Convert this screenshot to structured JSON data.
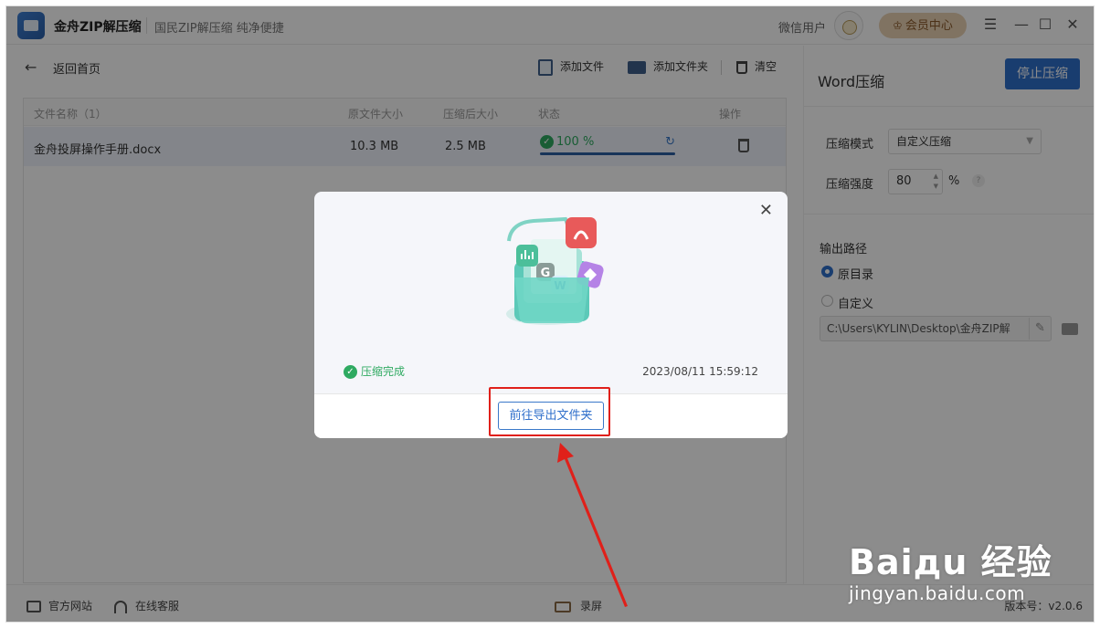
{
  "titlebar": {
    "app_name": "金舟ZIP解压缩",
    "slogan": "国民ZIP解压缩  纯净便捷",
    "user_name": "微信用户",
    "vip_label": "会员中心",
    "menu_icon": "☰",
    "min_icon": "—",
    "max_icon": "☐",
    "close_icon": "✕"
  },
  "toolbar": {
    "back_label": "返回首页",
    "add_file": "添加文件",
    "add_folder": "添加文件夹",
    "clear": "清空"
  },
  "table": {
    "headers": [
      "文件名称（1）",
      "原文件大小",
      "压缩后大小",
      "状态",
      "操作"
    ],
    "rows": [
      {
        "name": "金舟投屏操作手册.docx",
        "original_size": "10.3 MB",
        "compressed_size": "2.5 MB",
        "progress_text": "100 %",
        "progress": 1.0
      }
    ]
  },
  "side": {
    "title": "Word压缩",
    "stop_label": "停止压缩",
    "mode_label": "压缩模式",
    "mode_value": "自定义压缩",
    "strength_label": "压缩强度",
    "strength_value": "80",
    "percent": "%",
    "help": "?",
    "output_label": "输出路径",
    "option_original": "原目录",
    "option_custom": "自定义",
    "path_value": "C:\\Users\\KYLIN\\Desktop\\金舟ZIP解"
  },
  "statusbar": {
    "website": "官方网站",
    "support": "在线客服",
    "record": "录屏",
    "version": "版本号：v2.0.6"
  },
  "dialog": {
    "status": "压缩完成",
    "time": "2023/08/11 15:59:12",
    "export_label": "前往导出文件夹",
    "close": "✕"
  },
  "watermark": {
    "brand": "Baiдu 经验",
    "url": "jingyan.baidu.com"
  },
  "colors": {
    "accent": "#2f6fcb",
    "success": "#2faa61",
    "highlight": "#e0201a"
  }
}
